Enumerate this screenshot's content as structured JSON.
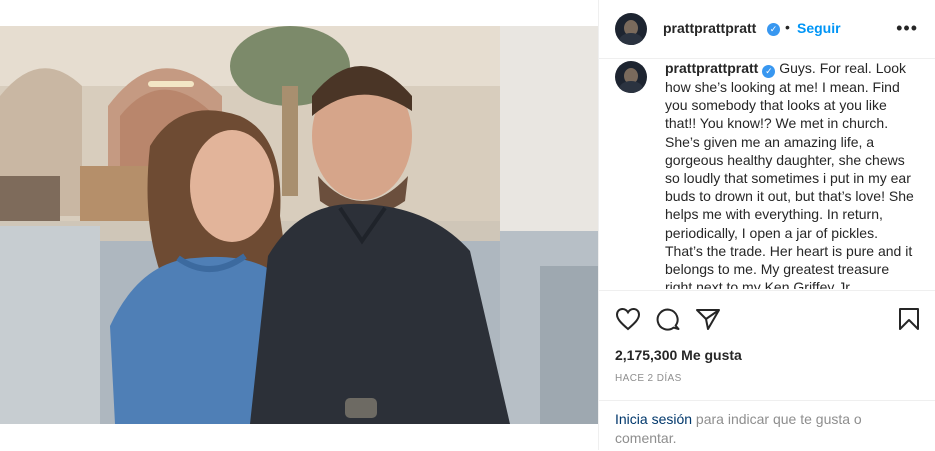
{
  "post": {
    "username": "prattprattpratt",
    "verified_glyph": "✓",
    "dot": "•",
    "follow_label": "Seguir",
    "more_label": "•••",
    "caption": "Guys. For real. Look how she’s looking at me! I mean. Find you somebody that looks at you like that!! You know!? We met in church. She’s given me an amazing life, a gorgeous healthy daughter, she chews so loudly that sometimes i put in my ear buds to drown it out, but that’s love! She helps me with everything. In return, periodically, I open a jar of pickles. That’s the trade. Her heart is pure and it belongs to me. My greatest treasure right next to my Ken Griffey Jr",
    "likes": "2,175,300 Me gusta",
    "timestamp": "HACE 2 DÍAS"
  },
  "actions": {
    "like_icon": "heart-icon",
    "comment_icon": "comment-icon",
    "share_icon": "paper-plane-icon",
    "save_icon": "bookmark-icon"
  },
  "login": {
    "link_label": "Inicia sesión",
    "rest_text": " para indicar que te gusta o comentar."
  },
  "colors": {
    "link_blue": "#0095f6",
    "verified_blue": "#3897f0",
    "muted": "#8e8e8e",
    "login_link": "#00376b"
  }
}
